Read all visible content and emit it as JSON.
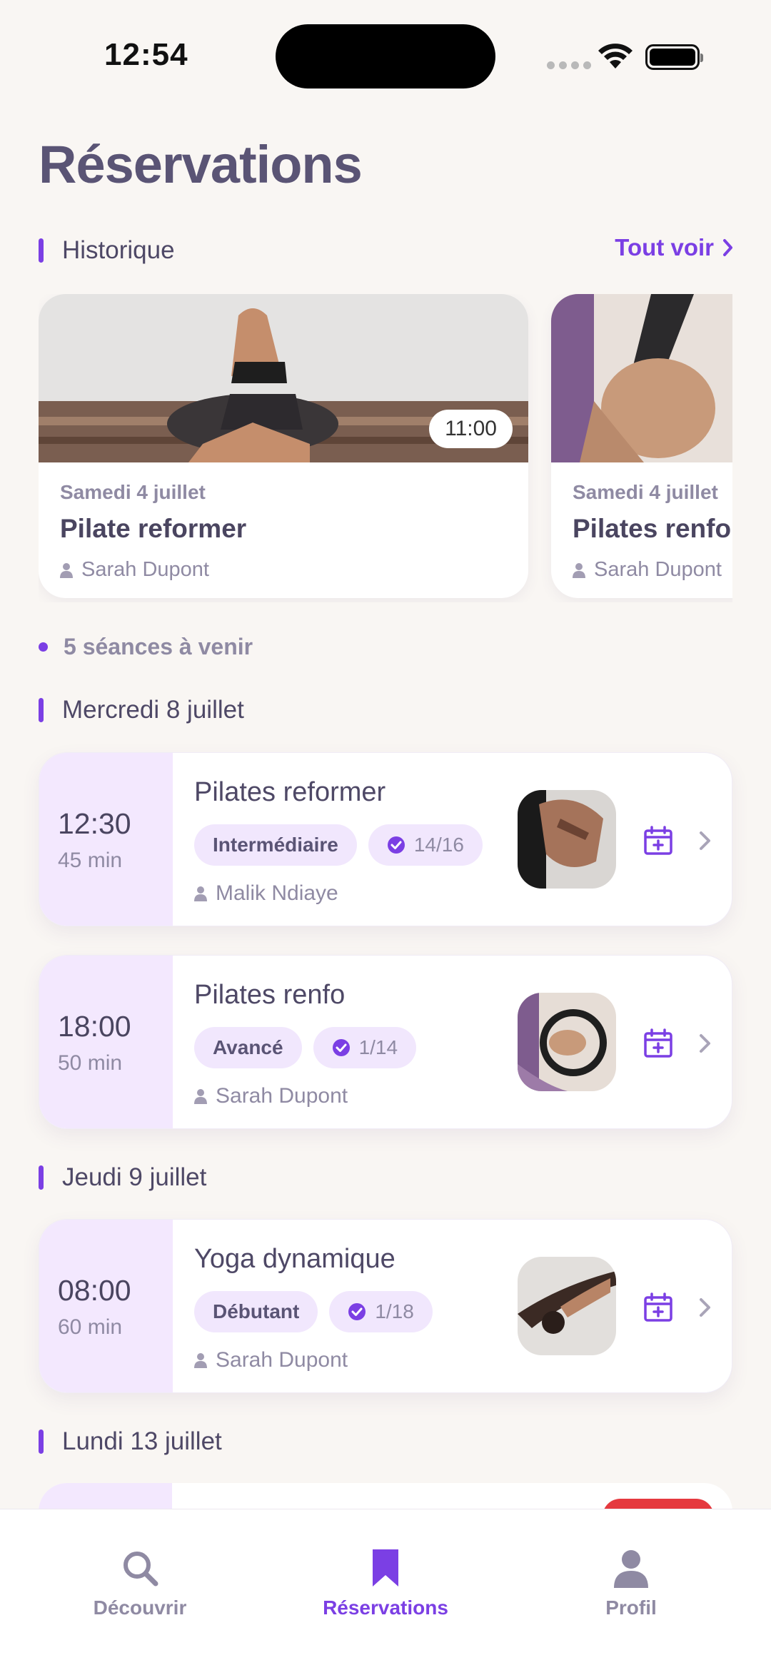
{
  "status_bar": {
    "time": "12:54"
  },
  "page": {
    "title": "Réservations"
  },
  "history": {
    "label": "Historique",
    "see_all": "Tout voir",
    "cards": [
      {
        "time": "11:00",
        "date": "Samedi 4 juillet",
        "title": "Pilate reformer",
        "coach": "Sarah Dupont"
      },
      {
        "date": "Samedi 4 juillet",
        "title": "Pilates renfo",
        "coach": "Sarah Dupont"
      }
    ]
  },
  "upcoming": {
    "count_label": "5 séances à venir"
  },
  "days": [
    {
      "label": "Mercredi 8 juillet",
      "sessions": [
        {
          "time": "12:30",
          "duration": "45 min",
          "title": "Pilates reformer",
          "level": "Intermédiaire",
          "spots": "14/16",
          "coach": "Malik Ndiaye"
        },
        {
          "time": "18:00",
          "duration": "50 min",
          "title": "Pilates renfo",
          "level": "Avancé",
          "spots": "1/14",
          "coach": "Sarah Dupont"
        }
      ]
    },
    {
      "label": "Jeudi 9 juillet",
      "sessions": [
        {
          "time": "08:00",
          "duration": "60 min",
          "title": "Yoga dynamique",
          "level": "Débutant",
          "spots": "1/18",
          "coach": "Sarah Dupont"
        }
      ]
    },
    {
      "label": "Lundi 13 juillet"
    }
  ],
  "tabs": [
    {
      "label": "Découvrir",
      "icon": "search-icon"
    },
    {
      "label": "Réservations",
      "icon": "bookmark-icon",
      "active": true
    },
    {
      "label": "Profil",
      "icon": "person-icon"
    }
  ],
  "colors": {
    "accent": "#7B3FE4",
    "time_block": "#F3E8FE",
    "tag_bg": "#F1E7FD",
    "badge_red": "#E5393F",
    "background": "#F9F6F3"
  }
}
